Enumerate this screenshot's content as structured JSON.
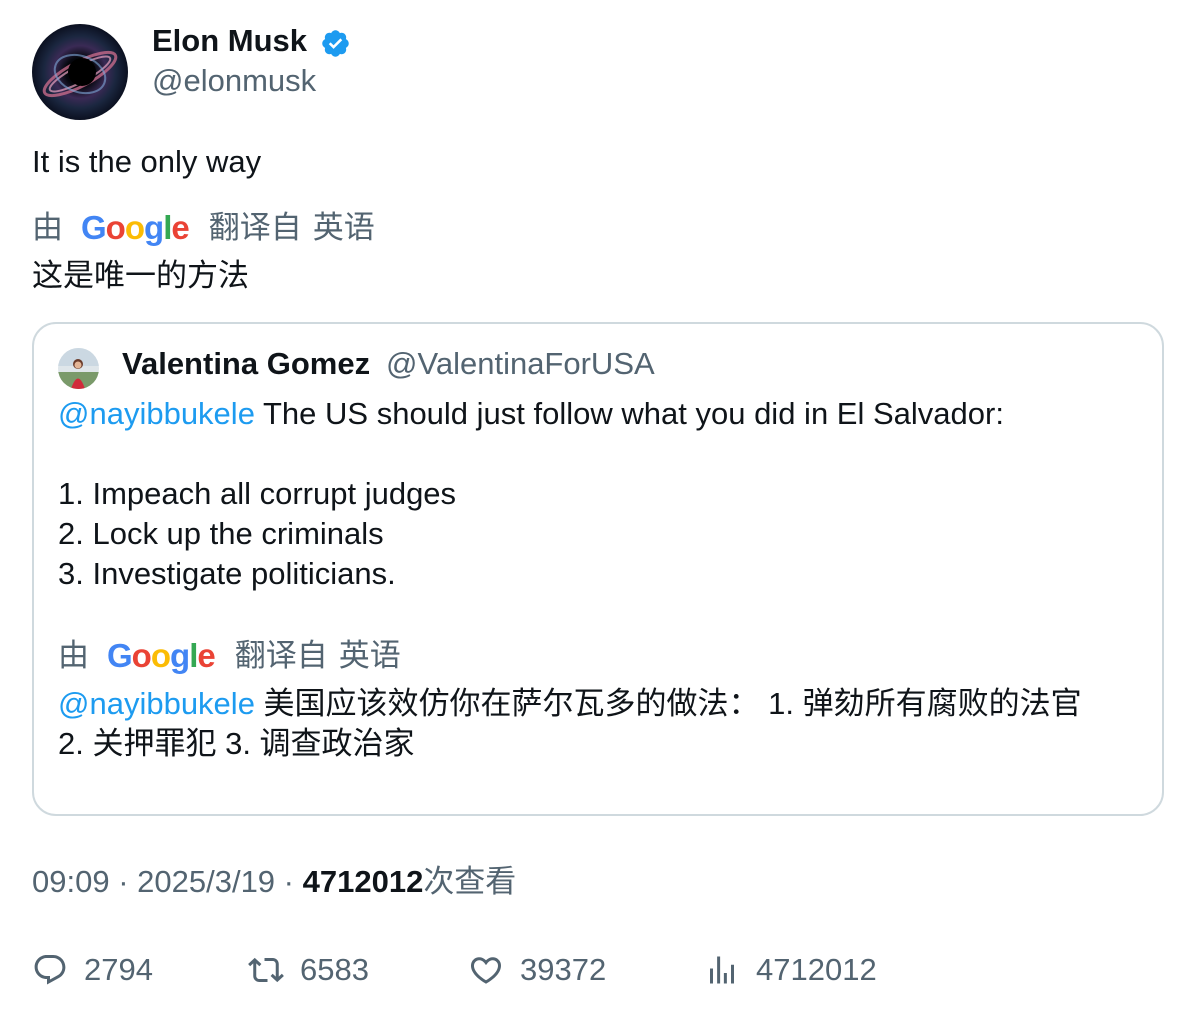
{
  "author": {
    "name": "Elon Musk",
    "handle": "@elonmusk",
    "verified_color": "#1d9bf0"
  },
  "tweet": {
    "text": "It is the only way",
    "translation": {
      "by_label": "由",
      "provider": "Google",
      "from_label": "翻译自",
      "language": "英语",
      "text": "这是唯一的方法"
    }
  },
  "quote": {
    "name": "Valentina Gomez",
    "handle": "@ValentinaForUSA",
    "mention": "@nayibbukele",
    "line1": " The US should just follow what you did in El Salvador:",
    "list": [
      "1. Impeach all corrupt judges",
      "2. Lock up the criminals",
      "3. Investigate politicians."
    ],
    "translation": {
      "by_label": "由",
      "provider": "Google",
      "from_label": "翻译自",
      "language": "英语",
      "mention": "@nayibbukele",
      "text_line1": " 美国应该效仿你在萨尔瓦多的做法： 1. 弹劾所有腐败的法官",
      "text_line2": "2. 关押罪犯 3. 调查政治家"
    }
  },
  "meta": {
    "time": "09:09",
    "separator": " · ",
    "date": "2025/3/19",
    "views_count": "4712012",
    "views_label": "次查看"
  },
  "actions": {
    "replies": "2794",
    "retweets": "6583",
    "likes": "39372",
    "views": "4712012"
  },
  "colors": {
    "text": "#0f1419",
    "secondary": "#536471",
    "link": "#1d9bf0",
    "border": "#cfd9de"
  }
}
